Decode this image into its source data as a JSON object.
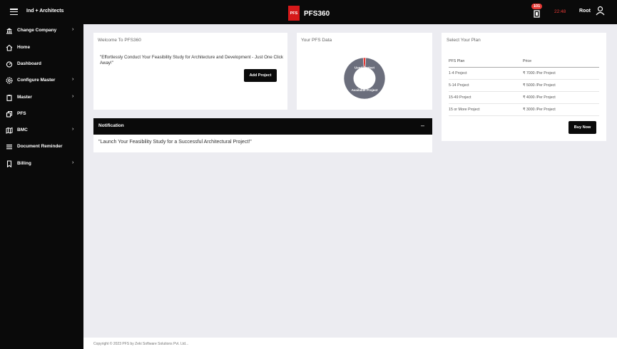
{
  "header": {
    "company": "Ind + Architects",
    "logo_text": "PFS",
    "app_title": "PFS360",
    "notification_count": "101",
    "clock": "22:48",
    "user": "Root"
  },
  "sidebar": {
    "items": [
      {
        "label": "Change Company",
        "icon": "bank-icon",
        "chevron": "›"
      },
      {
        "label": "Home",
        "icon": "home-icon"
      },
      {
        "label": "Dashboard",
        "icon": "gauge-icon"
      },
      {
        "label": "Configure Master",
        "icon": "gear-icon",
        "chevron": "›"
      },
      {
        "label": "Master",
        "icon": "clipboard-icon",
        "chevron": "›"
      },
      {
        "label": "PFS",
        "icon": "copy-icon"
      },
      {
        "label": "BMC",
        "icon": "map-icon",
        "chevron": "›"
      },
      {
        "label": "Document Reminder",
        "icon": "list-icon"
      },
      {
        "label": "Billing",
        "icon": "bookmark-icon",
        "chevron": "›"
      }
    ]
  },
  "welcome": {
    "title": "Welcome To PFS360",
    "text": "\"Effortlessly Conduct Your Feasibility Study for Architecture and Development - Just One Click Away!\"",
    "button": "Add Project"
  },
  "pfs_data": {
    "title": "Your PFS Data",
    "chart_data": {
      "type": "pie",
      "labels": [
        "Used Project",
        "Available Project"
      ],
      "values": [
        2,
        98
      ],
      "colors": [
        "#e53935",
        "#6b6e7c"
      ]
    }
  },
  "plan": {
    "title": "Select Your Plan",
    "headers": [
      "PFS Plan",
      "Price"
    ],
    "rows": [
      [
        "1-4 Project",
        "₹ 7000 /Per Project"
      ],
      [
        "5-14 Project",
        "₹ 5000 /Per Project"
      ],
      [
        "15-49 Project",
        "₹ 4000 /Per Project"
      ],
      [
        "15 or More Project",
        "₹ 3000 /Per Project"
      ]
    ],
    "button": "Buy Now"
  },
  "notification": {
    "title": "Notification",
    "collapse": "–",
    "text": "\"Launch Your Feasibility Study for a Successful Architectural Project!\""
  },
  "footer": {
    "text": "Copyright © 2023 PFS by Zeki Software Solutions Pvt. Ltd..."
  }
}
